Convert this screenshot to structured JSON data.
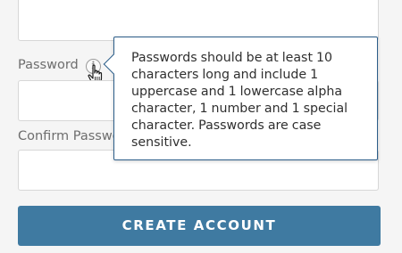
{
  "form": {
    "password_label": "Password",
    "confirm_password_label": "Confirm Passwo",
    "info_icon": "info-icon",
    "tooltip_text": "Passwords should be at least 10 characters long and include 1 uppercase and 1 lowercase alpha character, 1 number and 1 special character. Passwords are case sensitive.",
    "create_account_label": "CREATE ACCOUNT"
  },
  "colors": {
    "button": "#3f7aa1",
    "tooltip_border": "#2c5e8a",
    "label_text": "#6e6e6e",
    "background": "#f5f5f5"
  }
}
